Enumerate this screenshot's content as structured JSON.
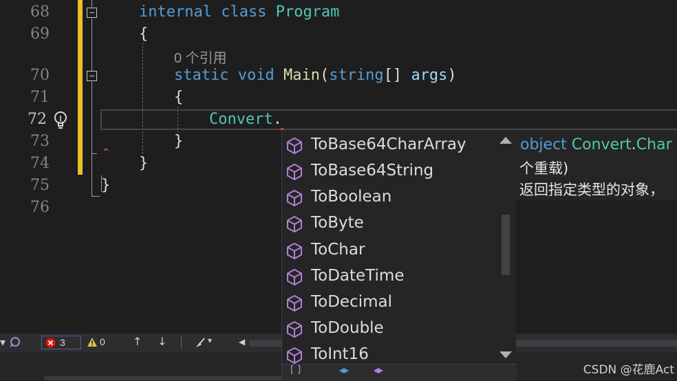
{
  "editor": {
    "line_numbers": [
      "68",
      "69",
      "70",
      "71",
      "72",
      "73",
      "74",
      "75",
      "76"
    ],
    "code_reference_lens": "0 个引用",
    "line68": {
      "kw1": "internal",
      "kw2": "class",
      "type": "Program"
    },
    "line69": {
      "brace": "{"
    },
    "line70": {
      "kw1": "static",
      "kw2": "void",
      "method": "Main",
      "open": "(",
      "ptype": "string",
      "arr": "[]",
      "param": "args",
      "close": ")"
    },
    "line71": {
      "brace": "{"
    },
    "line72": {
      "type": "Convert",
      "dot": "."
    },
    "line73": {
      "brace": "}"
    },
    "line74": {
      "brace": "}"
    },
    "line75": {
      "brace": "}"
    }
  },
  "completion": {
    "items": [
      "ToBase64CharArray",
      "ToBase64String",
      "ToBoolean",
      "ToByte",
      "ToChar",
      "ToDateTime",
      "ToDecimal",
      "ToDouble",
      "ToInt16"
    ],
    "item_icon": "method-cube-icon"
  },
  "tooltip": {
    "kw": "object",
    "type": "Convert",
    "dot": ".",
    "member": "Char",
    "line2": "个重载)",
    "line3": "返回指定类型的对象，"
  },
  "status": {
    "errors": "3",
    "warnings": "0"
  },
  "watermark": "CSDN @花鹿Act",
  "colors": {
    "keyword": "#569cd6",
    "type": "#4ec9b0",
    "change_bar": "#e6c229",
    "method_icon": "#b180d7"
  }
}
